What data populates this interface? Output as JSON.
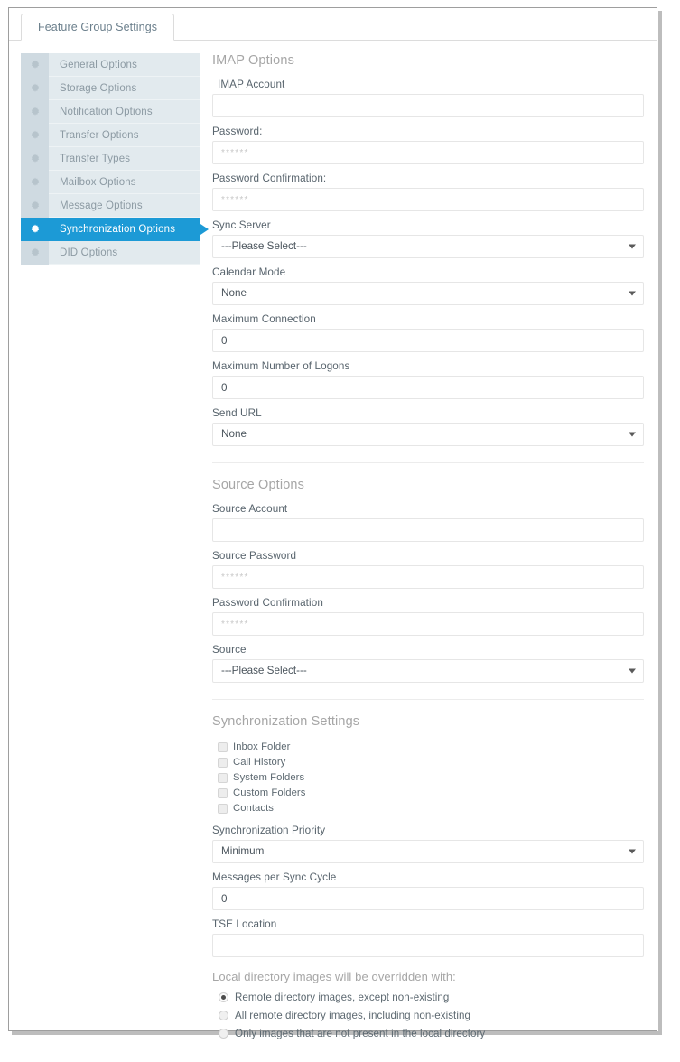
{
  "window": {
    "frame_border_color": "#9e9e9e",
    "accent_color": "#1c9ad6"
  },
  "tabs": [
    {
      "label": "Feature Group Settings",
      "active": true
    }
  ],
  "sidebar": {
    "icon": "gear-icon",
    "items": [
      {
        "label": "General Options",
        "active": false
      },
      {
        "label": "Storage Options",
        "active": false
      },
      {
        "label": "Notification Options",
        "active": false
      },
      {
        "label": "Transfer Options",
        "active": false
      },
      {
        "label": "Transfer Types",
        "active": false
      },
      {
        "label": "Mailbox Options",
        "active": false
      },
      {
        "label": "Message Options",
        "active": false
      },
      {
        "label": "Synchronization Options",
        "active": true
      },
      {
        "label": "DID Options",
        "active": false
      }
    ]
  },
  "imap_options": {
    "title": "IMAP Options",
    "account_label": "IMAP Account",
    "account_value": "",
    "password_label": "Password:",
    "password_value": "******",
    "password_confirm_label": "Password Confirmation:",
    "password_confirm_value": "******",
    "sync_server_label": "Sync Server",
    "sync_server_value": "---Please Select---",
    "calendar_mode_label": "Calendar Mode",
    "calendar_mode_value": "None",
    "max_connection_label": "Maximum Connection",
    "max_connection_value": "0",
    "max_logons_label": "Maximum Number of Logons",
    "max_logons_value": "0",
    "send_url_label": "Send URL",
    "send_url_value": "None"
  },
  "source_options": {
    "title": "Source Options",
    "account_label": "Source Account",
    "account_value": "",
    "password_label": "Source Password",
    "password_value": "******",
    "password_confirm_label": "Password Confirmation",
    "password_confirm_value": "******",
    "source_label": "Source",
    "source_value": "---Please Select---"
  },
  "sync_settings": {
    "title": "Synchronization Settings",
    "checkboxes": [
      {
        "label": "Inbox Folder",
        "checked": false
      },
      {
        "label": "Call History",
        "checked": false
      },
      {
        "label": "System Folders",
        "checked": false
      },
      {
        "label": "Custom Folders",
        "checked": false
      },
      {
        "label": "Contacts",
        "checked": false
      }
    ],
    "priority_label": "Synchronization Priority",
    "priority_value": "Minimum",
    "messages_per_cycle_label": "Messages per Sync Cycle",
    "messages_per_cycle_value": "0",
    "tse_location_label": "TSE Location",
    "tse_location_value": "",
    "override_title": "Local directory images will be overridden with:",
    "radios": [
      {
        "label": "Remote directory images, except non-existing",
        "selected": true
      },
      {
        "label": "All remote directory images, including non-existing",
        "selected": false
      },
      {
        "label": "Only images that are not present in the local directory",
        "selected": false
      }
    ]
  }
}
